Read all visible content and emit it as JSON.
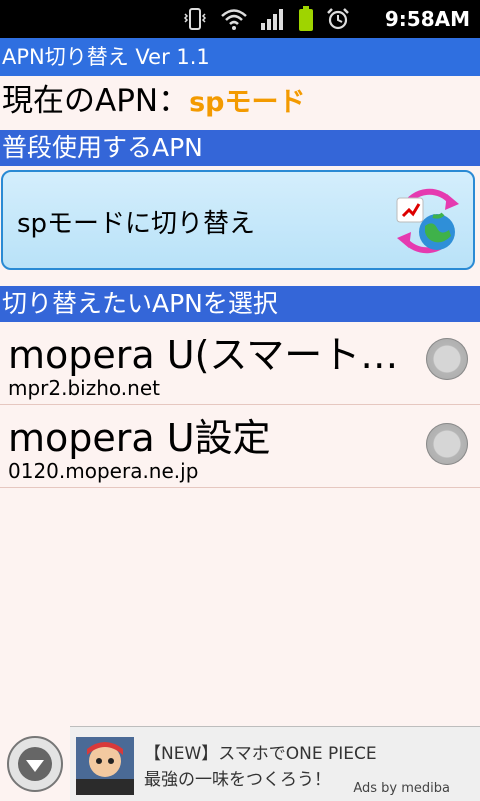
{
  "status_bar": {
    "time": "9:58AM"
  },
  "app": {
    "title": "APN切り替え Ver 1.1"
  },
  "current": {
    "label": "現在のAPN：",
    "value": "spモード"
  },
  "sections": {
    "normal": "普段使用するAPN",
    "select": "切り替えたいAPNを選択"
  },
  "switch_button": {
    "label": "spモードに切り替え"
  },
  "apn_list": [
    {
      "name": "mopera U(スマート…",
      "host": "mpr2.bizho.net"
    },
    {
      "name": "mopera U設定",
      "host": "0120.mopera.ne.jp"
    }
  ],
  "ad": {
    "line1": "【NEW】スマホでONE PIECE",
    "line2": "最強の一味をつくろう！",
    "credit": "Ads by mediba"
  },
  "colors": {
    "titlebar": "#2f6fe0",
    "section": "#3466d8",
    "current_value": "#f39a00",
    "background": "#fdf3f1"
  }
}
